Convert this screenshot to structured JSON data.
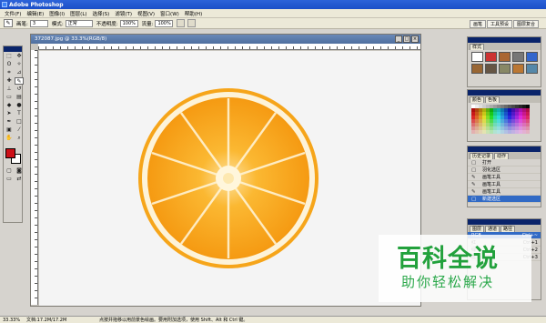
{
  "window": {
    "title": "Adobe Photoshop"
  },
  "menu": [
    "文件(F)",
    "编辑(E)",
    "图像(I)",
    "图层(L)",
    "选择(S)",
    "滤镜(T)",
    "视图(V)",
    "窗口(W)",
    "帮助(H)"
  ],
  "options": {
    "brush_label": "画笔:",
    "brush_size": "3",
    "mode_label": "模式:",
    "mode_value": "正常",
    "opacity_label": "不透明度:",
    "opacity_value": "100%",
    "flow_label": "流量:",
    "flow_value": "100%",
    "well_tabs": [
      "画笔",
      "工具预设",
      "图层复合"
    ]
  },
  "document": {
    "title": "372087.jpg @ 33.3%(RGB/8)"
  },
  "panels": {
    "styles_tab": "样式",
    "swatches_tabs": [
      "颜色",
      "色板"
    ],
    "history_tabs": [
      "历史记录",
      "动作"
    ],
    "history_items": [
      "打开",
      "羽化选区",
      "画笔工具",
      "画笔工具",
      "画笔工具",
      "新建选区"
    ],
    "layers_tabs": [
      "图层",
      "通道",
      "路径"
    ],
    "layers_rows": [
      {
        "name": "RGB",
        "shortcut": "Ctrl+~"
      },
      {
        "name": "红",
        "shortcut": "Ctrl+1"
      },
      {
        "name": "绿",
        "shortcut": "Ctrl+2"
      },
      {
        "name": "蓝",
        "shortcut": "Ctrl+3"
      }
    ]
  },
  "status": {
    "zoom": "33.33%",
    "doc_size": "文档:17.2M/17.2M",
    "hint": "点按并拖移以用前景色绘画。要用附加选项，使用 Shift、Alt 和 Ctrl 键。"
  },
  "watermark": {
    "title": "百科全说",
    "subtitle": "助你轻松解决"
  },
  "colors": {
    "foreground": "#cc1018",
    "background": "#ffffff",
    "titlebar": "#1b4fc7",
    "orange": "#f7a81b",
    "highlight": "#316ac5",
    "watermark_green": "#22a13c"
  }
}
